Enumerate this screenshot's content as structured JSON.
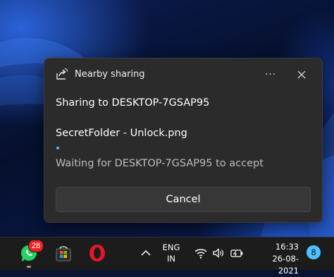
{
  "panel": {
    "app_title": "Nearby sharing",
    "more_label": "···",
    "heading": "Sharing to DESKTOP-7GSAP95",
    "filename": "SecretFolder - Unlock.png",
    "status": "Waiting for DESKTOP-7GSAP95 to accept",
    "cancel_label": "Cancel",
    "accent_color": "#4cc2ff"
  },
  "taskbar": {
    "apps": [
      {
        "icon": "whatsapp-icon",
        "badge": "28"
      },
      {
        "icon": "microsoft-store-icon"
      },
      {
        "icon": "opera-icon"
      }
    ],
    "language": {
      "line1": "ENG",
      "line2": "IN"
    },
    "clock": {
      "time": "16:33",
      "date": "26-08-2021"
    },
    "notification_count": "8"
  }
}
